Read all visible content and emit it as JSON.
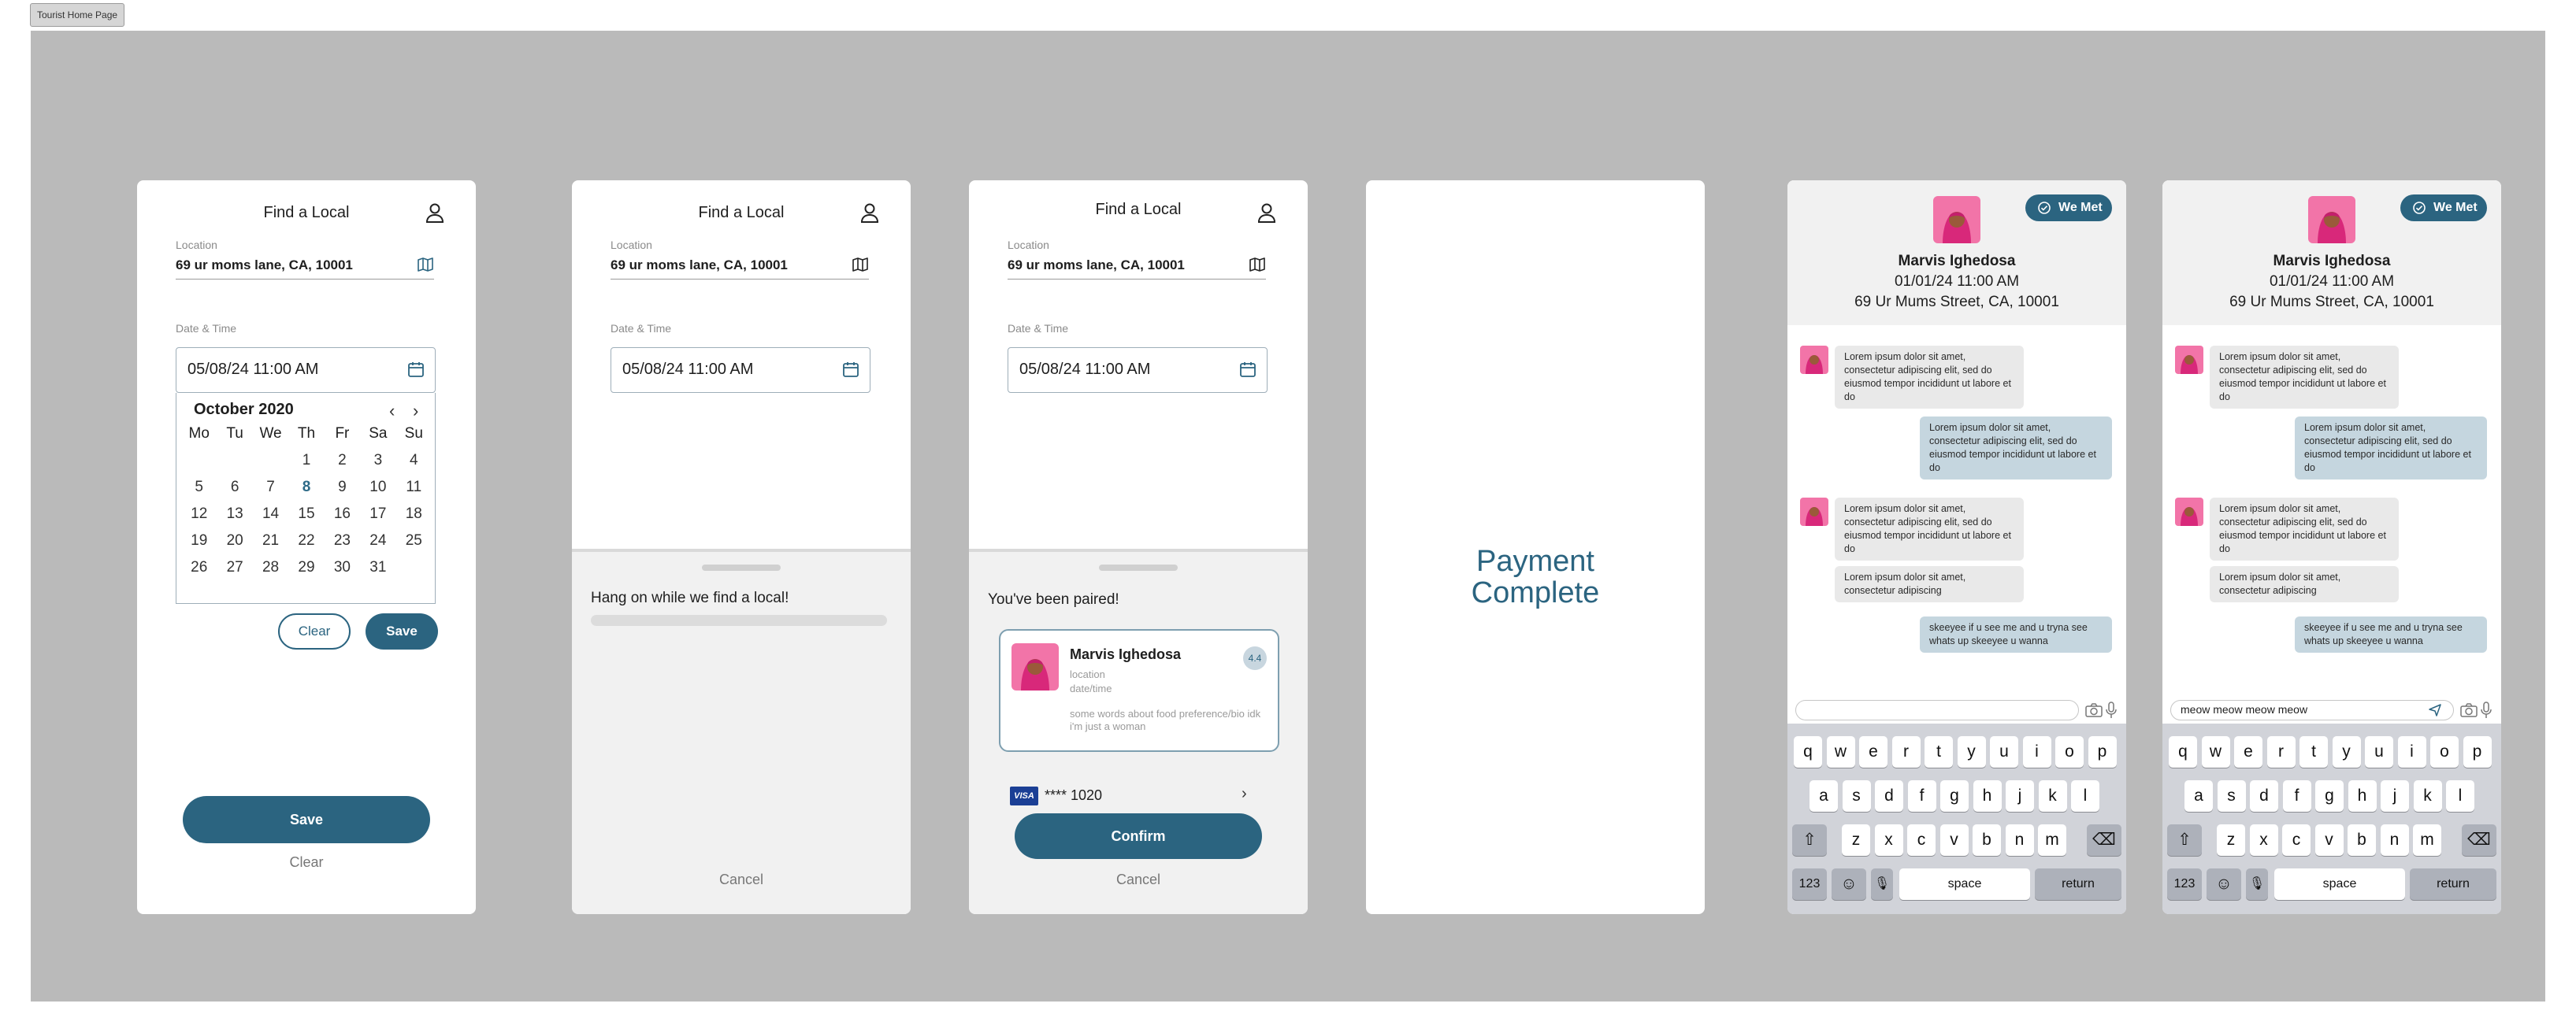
{
  "frame_label": "Tourist Home Page",
  "header": {
    "title": "Find a Local"
  },
  "location": {
    "label": "Location",
    "value": "69 ur moms lane, CA, 10001"
  },
  "datetime": {
    "label": "Date & Time",
    "value": "05/08/24 11:00 AM"
  },
  "calendar": {
    "month": "October 2020",
    "weekdays": [
      "Mo",
      "Tu",
      "We",
      "Th",
      "Fr",
      "Sa",
      "Su"
    ],
    "days": [
      "",
      "",
      "",
      "1",
      "2",
      "3",
      "4",
      "5",
      "6",
      "7",
      "8",
      "9",
      "10",
      "11",
      "12",
      "13",
      "14",
      "15",
      "16",
      "17",
      "18",
      "19",
      "20",
      "21",
      "22",
      "23",
      "24",
      "25",
      "26",
      "27",
      "28",
      "29",
      "30",
      "31",
      ""
    ],
    "selected": "8",
    "clear_label": "Clear",
    "save_label": "Save"
  },
  "main_actions": {
    "save_label": "Save",
    "clear_label": "Clear"
  },
  "searching": {
    "message": "Hang on while we find a local!",
    "cancel_label": "Cancel"
  },
  "paired": {
    "title": "You've been paired!",
    "name": "Marvis Ighedosa",
    "rating": "4.4",
    "location_placeholder": "location",
    "datetime_placeholder": "date/time",
    "bio": "some words about food preference/bio idk i'm just a woman",
    "card_brand": "VISA",
    "card_number": "**** 1020",
    "confirm_label": "Confirm",
    "cancel_label": "Cancel"
  },
  "payment": {
    "line1": "Payment",
    "line2": "Complete"
  },
  "chat": {
    "we_met_label": "We Met",
    "name": "Marvis Ighedosa",
    "date": "01/01/24 11:00 AM",
    "address": "69 Ur Mums Street, CA, 10001",
    "messages": [
      {
        "from": "them",
        "text": "Lorem ipsum dolor sit amet, consectetur adipiscing elit, sed do eiusmod tempor incididunt ut labore et do"
      },
      {
        "from": "me",
        "text": "Lorem ipsum dolor sit amet, consectetur adipiscing elit, sed do eiusmod tempor incididunt ut labore et do"
      },
      {
        "from": "them",
        "text": "Lorem ipsum dolor sit amet, consectetur adipiscing elit, sed do eiusmod tempor incididunt ut labore et do"
      },
      {
        "from": "them",
        "text": "Lorem ipsum dolor sit amet, consectetur adipiscing"
      },
      {
        "from": "me",
        "text": "skeeyee if u see me and u tryna see whats up skeeyee u wanna"
      }
    ],
    "draft_empty": "",
    "draft_typed": "meow meow meow meow"
  },
  "keyboard": {
    "row1": [
      "q",
      "w",
      "e",
      "r",
      "t",
      "y",
      "u",
      "i",
      "o",
      "p"
    ],
    "row2": [
      "a",
      "s",
      "d",
      "f",
      "g",
      "h",
      "j",
      "k",
      "l"
    ],
    "row3": [
      "z",
      "x",
      "c",
      "v",
      "b",
      "n",
      "m"
    ],
    "numbers_label": "123",
    "space_label": "space",
    "return_label": "return"
  },
  "colors": {
    "accent": "#2b6480",
    "canvas": "#bababa",
    "avatar": "#f274a8",
    "outgoing_bubble": "#c5d6df",
    "incoming_bubble": "#e9e9e9"
  }
}
